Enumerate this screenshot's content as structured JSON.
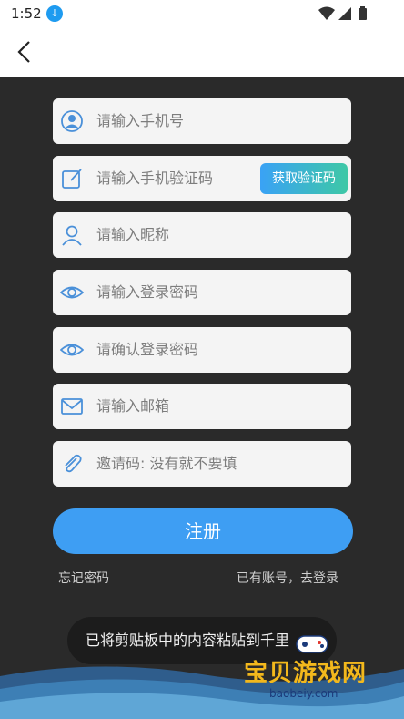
{
  "status_bar": {
    "time": "1:52"
  },
  "form": {
    "phone_placeholder": "请输入手机号",
    "code_placeholder": "请输入手机验证码",
    "get_code_label": "获取验证码",
    "nickname_placeholder": "请输入昵称",
    "password_placeholder": "请输入登录密码",
    "confirm_password_placeholder": "请确认登录密码",
    "email_placeholder": "请输入邮箱",
    "invite_placeholder": "邀请码: 没有就不要填"
  },
  "actions": {
    "register_label": "注册",
    "forgot_password": "忘记密码",
    "have_account": "已有账号，去登录"
  },
  "toast": {
    "text": "已将剪贴板中的内容粘贴到千里"
  },
  "watermark": {
    "cn": "宝贝游戏网",
    "en": "baobeiy.com"
  },
  "colors": {
    "accent": "#3e9ef3",
    "background": "#2a2a2a",
    "field": "#f4f4f4",
    "icon": "#4a90d9"
  },
  "icons": [
    "download-icon",
    "wifi-icon",
    "signal-icon",
    "battery-icon",
    "back-arrow-icon",
    "user-circle-icon",
    "edit-icon",
    "user-icon",
    "eye-icon",
    "mail-icon",
    "paperclip-icon"
  ]
}
